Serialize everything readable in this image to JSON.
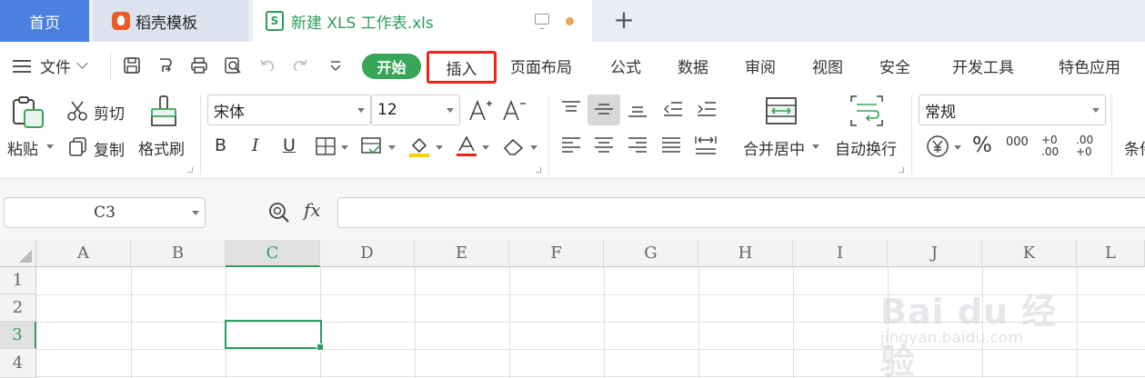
{
  "tabs": {
    "home": "首页",
    "template": "稻壳模板",
    "file": "新建 XLS 工作表.xls",
    "file_badge": "S"
  },
  "menu": {
    "file": "文件",
    "start": "开始",
    "insert": "插入",
    "items": [
      "页面布局",
      "公式",
      "数据",
      "审阅",
      "视图",
      "安全",
      "开发工具",
      "特色应用"
    ]
  },
  "ribbon": {
    "paste": "粘贴",
    "cut": "剪切",
    "copy": "复制",
    "format_painter": "格式刷",
    "font_name": "宋体",
    "font_size": "12",
    "bold": "B",
    "italic": "I",
    "underline": "U",
    "merge_center": "合并居中",
    "wrap_text": "自动换行",
    "number_format": "常规",
    "percent": "%",
    "thousands": "000",
    "dec_increase": "+0 .00",
    "dec_decrease": ".00 +0",
    "conditional": "条件"
  },
  "formula_bar": {
    "name_box": "C3",
    "fx": "fx",
    "value": ""
  },
  "sheet": {
    "columns": [
      "A",
      "B",
      "C",
      "D",
      "E",
      "F",
      "G",
      "H",
      "I",
      "J",
      "K",
      "L"
    ],
    "rows": [
      "1",
      "2",
      "3",
      "4"
    ],
    "active_column": "C",
    "active_row": "3"
  },
  "watermark": {
    "main": "Bai du 经验",
    "sub": "jingyan.baidu.com"
  },
  "colors": {
    "home_tab": "#4a80e0",
    "accent_green": "#37a657",
    "highlight_red": "#e8261c"
  }
}
